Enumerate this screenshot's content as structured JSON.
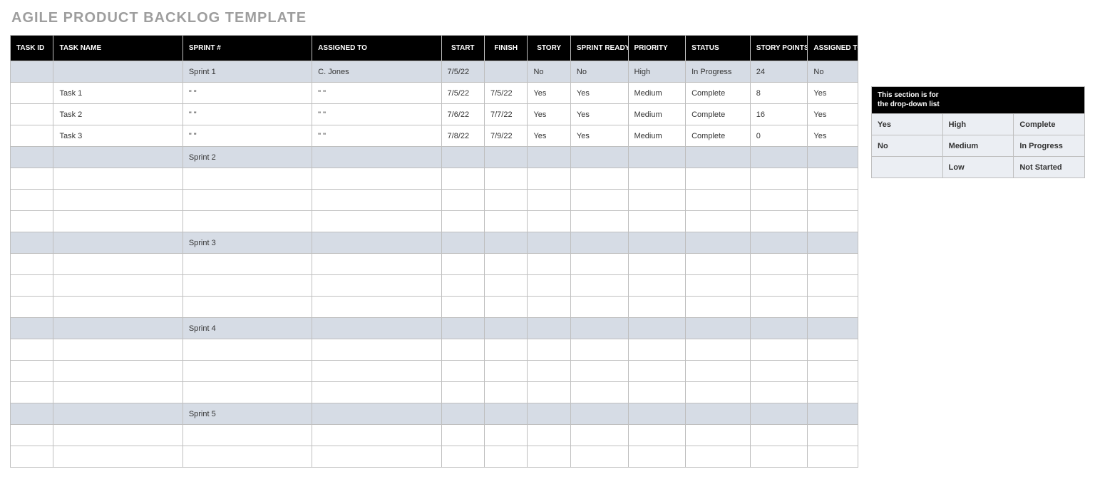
{
  "title": "AGILE PRODUCT BACKLOG TEMPLATE",
  "columns": [
    "TASK ID",
    "TASK NAME",
    "SPRINT #",
    "ASSIGNED TO",
    "START",
    "FINISH",
    "STORY",
    "SPRINT READY",
    "PRIORITY",
    "STATUS",
    "STORY POINTS",
    "ASSIGNED TO SPRINT"
  ],
  "rows": [
    {
      "type": "sprint",
      "cells": [
        "",
        "",
        "Sprint 1",
        "C. Jones",
        "7/5/22",
        "",
        "No",
        "No",
        "High",
        "In Progress",
        "24",
        "No"
      ]
    },
    {
      "type": "task",
      "cells": [
        "",
        "Task 1",
        "\" \"",
        "\" \"",
        "7/5/22",
        "7/5/22",
        "Yes",
        "Yes",
        "Medium",
        "Complete",
        "8",
        "Yes"
      ]
    },
    {
      "type": "task",
      "cells": [
        "",
        "Task 2",
        "\" \"",
        "\" \"",
        "7/6/22",
        "7/7/22",
        "Yes",
        "Yes",
        "Medium",
        "Complete",
        "16",
        "Yes"
      ]
    },
    {
      "type": "task",
      "cells": [
        "",
        "Task 3",
        "\" \"",
        "\" \"",
        "7/8/22",
        "7/9/22",
        "Yes",
        "Yes",
        "Medium",
        "Complete",
        "0",
        "Yes"
      ]
    },
    {
      "type": "sprint",
      "cells": [
        "",
        "",
        "Sprint 2",
        "",
        "",
        "",
        "",
        "",
        "",
        "",
        "",
        ""
      ]
    },
    {
      "type": "blank",
      "cells": [
        "",
        "",
        "",
        "",
        "",
        "",
        "",
        "",
        "",
        "",
        "",
        ""
      ]
    },
    {
      "type": "blank",
      "cells": [
        "",
        "",
        "",
        "",
        "",
        "",
        "",
        "",
        "",
        "",
        "",
        ""
      ]
    },
    {
      "type": "blank",
      "cells": [
        "",
        "",
        "",
        "",
        "",
        "",
        "",
        "",
        "",
        "",
        "",
        ""
      ]
    },
    {
      "type": "sprint",
      "cells": [
        "",
        "",
        "Sprint 3",
        "",
        "",
        "",
        "",
        "",
        "",
        "",
        "",
        ""
      ]
    },
    {
      "type": "blank",
      "cells": [
        "",
        "",
        "",
        "",
        "",
        "",
        "",
        "",
        "",
        "",
        "",
        ""
      ]
    },
    {
      "type": "blank",
      "cells": [
        "",
        "",
        "",
        "",
        "",
        "",
        "",
        "",
        "",
        "",
        "",
        ""
      ]
    },
    {
      "type": "blank",
      "cells": [
        "",
        "",
        "",
        "",
        "",
        "",
        "",
        "",
        "",
        "",
        "",
        ""
      ]
    },
    {
      "type": "sprint",
      "cells": [
        "",
        "",
        "Sprint 4",
        "",
        "",
        "",
        "",
        "",
        "",
        "",
        "",
        ""
      ]
    },
    {
      "type": "blank",
      "cells": [
        "",
        "",
        "",
        "",
        "",
        "",
        "",
        "",
        "",
        "",
        "",
        ""
      ]
    },
    {
      "type": "blank",
      "cells": [
        "",
        "",
        "",
        "",
        "",
        "",
        "",
        "",
        "",
        "",
        "",
        ""
      ]
    },
    {
      "type": "blank",
      "cells": [
        "",
        "",
        "",
        "",
        "",
        "",
        "",
        "",
        "",
        "",
        "",
        ""
      ]
    },
    {
      "type": "sprint",
      "cells": [
        "",
        "",
        "Sprint 5",
        "",
        "",
        "",
        "",
        "",
        "",
        "",
        "",
        ""
      ]
    },
    {
      "type": "blank",
      "cells": [
        "",
        "",
        "",
        "",
        "",
        "",
        "",
        "",
        "",
        "",
        "",
        ""
      ]
    },
    {
      "type": "blank",
      "cells": [
        "",
        "",
        "",
        "",
        "",
        "",
        "",
        "",
        "",
        "",
        "",
        ""
      ]
    }
  ],
  "dropdown": {
    "header": "This section is for\nthe drop-down list",
    "rows": [
      [
        "Yes",
        "High",
        "Complete"
      ],
      [
        "No",
        "Medium",
        "In Progress"
      ],
      [
        "",
        "Low",
        "Not Started"
      ]
    ]
  }
}
